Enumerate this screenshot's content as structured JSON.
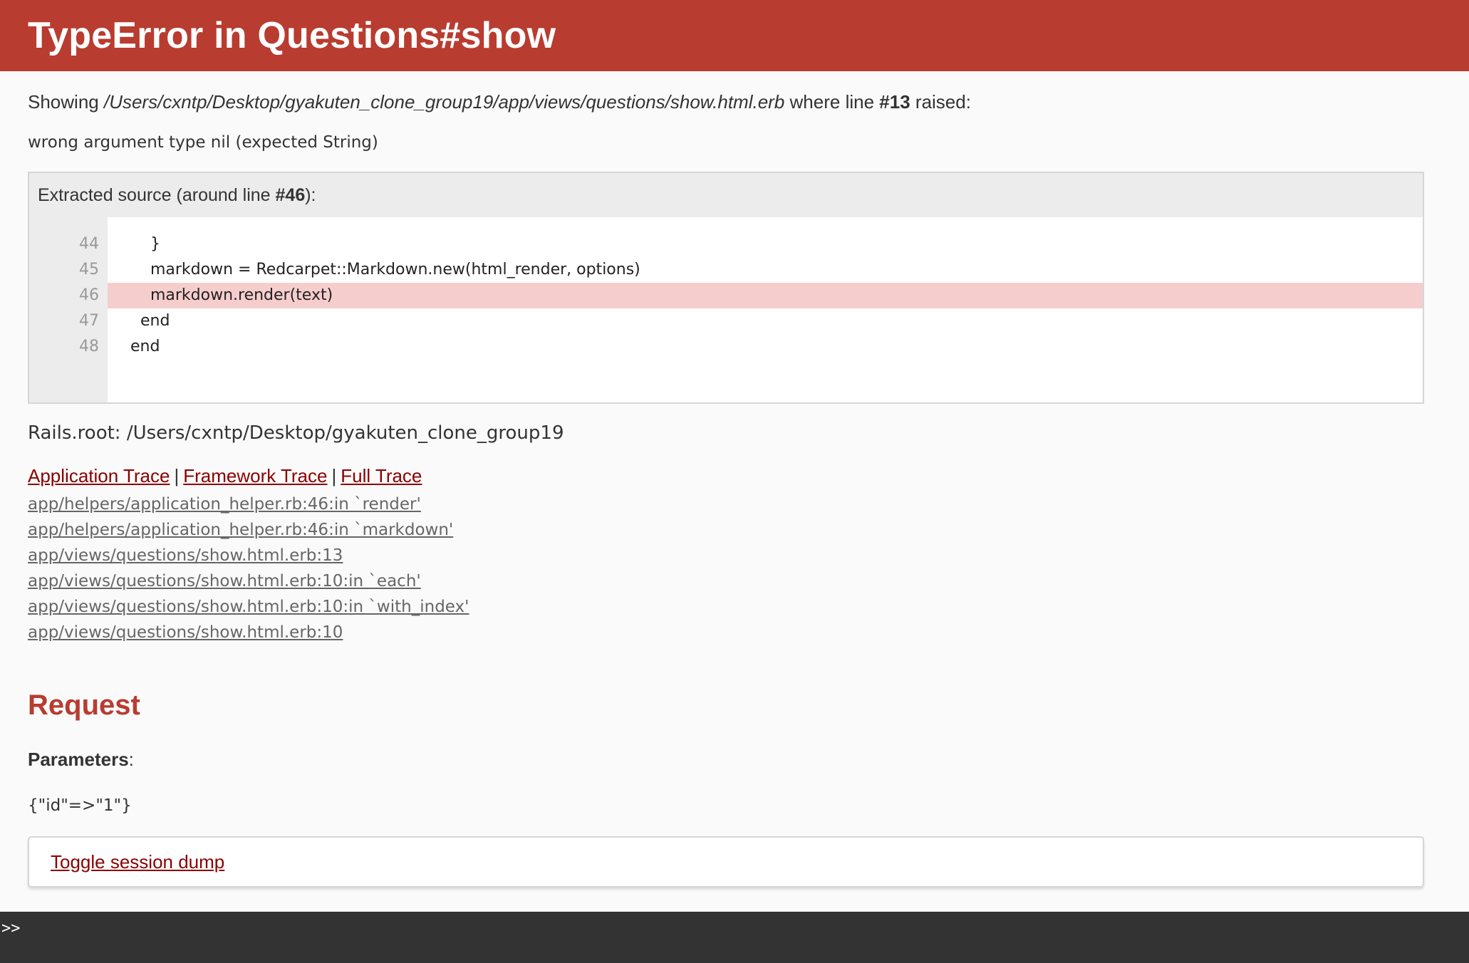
{
  "header": {
    "title": "TypeError in Questions#show"
  },
  "showing": {
    "prefix": "Showing",
    "path": "/Users/cxntp/Desktop/gyakuten_clone_group19/app/views/questions/show.html.erb",
    "middle": "where line",
    "line": "#13",
    "suffix": "raised:"
  },
  "error_message": "wrong argument type nil (expected String)",
  "source": {
    "title_prefix": "Extracted source (around line",
    "title_line": "#46",
    "title_suffix": "):",
    "lines": [
      {
        "num": "44",
        "code": "      }"
      },
      {
        "num": "45",
        "code": "      markdown = Redcarpet::Markdown.new(html_render, options)"
      },
      {
        "num": "46",
        "code": "      markdown.render(text)"
      },
      {
        "num": "47",
        "code": "    end"
      },
      {
        "num": "48",
        "code": "  end"
      }
    ]
  },
  "rails_root": "Rails.root: /Users/cxntp/Desktop/gyakuten_clone_group19",
  "trace_links": {
    "application": "Application Trace",
    "framework": "Framework Trace",
    "full": "Full Trace",
    "separator": "|"
  },
  "trace": [
    "app/helpers/application_helper.rb:46:in `render'",
    "app/helpers/application_helper.rb:46:in `markdown'",
    "app/views/questions/show.html.erb:13",
    "app/views/questions/show.html.erb:10:in `each'",
    "app/views/questions/show.html.erb:10:in `with_index'",
    "app/views/questions/show.html.erb:10"
  ],
  "request": {
    "heading": "Request",
    "params_label": "Parameters",
    "params_colon": ":",
    "params_value": "{\"id\"=>\"1\"}",
    "toggle_session": "Toggle session dump"
  },
  "console": {
    "prompt": ">>"
  }
}
